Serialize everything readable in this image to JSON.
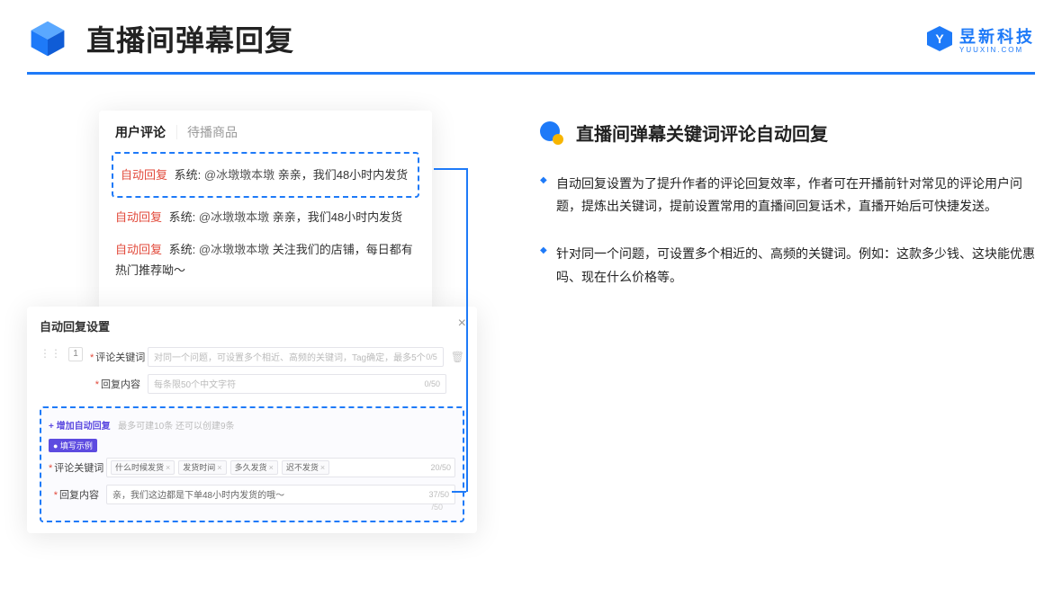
{
  "header": {
    "title": "直播间弹幕回复",
    "brand_text": "昱新科技",
    "brand_sub": "YUUXIN.COM",
    "brand_letter": "Y"
  },
  "right": {
    "title": "直播间弹幕关键词评论自动回复",
    "bullets": [
      "自动回复设置为了提升作者的评论回复效率，作者可在开播前针对常见的评论用户问题，提炼出关键词，提前设置常用的直播间回复话术，直播开始后可快捷发送。",
      "针对同一个问题，可设置多个相近的、高频的关键词。例如：这款多少钱、这块能优惠吗、现在什么价格等。"
    ]
  },
  "comments": {
    "tabs": [
      "用户评论",
      "待播商品"
    ],
    "rows": [
      {
        "tag": "自动回复",
        "prefix": "系统:",
        "mention": "@冰墩墩本墩",
        "text": " 亲亲，我们48小时内发货"
      },
      {
        "tag": "自动回复",
        "prefix": "系统:",
        "mention": "@冰墩墩本墩",
        "text": " 亲亲，我们48小时内发货"
      },
      {
        "tag": "自动回复",
        "prefix": "系统:",
        "mention": "@冰墩墩本墩",
        "text": " 关注我们的店铺，每日都有热门推荐呦～"
      }
    ]
  },
  "settings": {
    "title": "自动回复设置",
    "close": "×",
    "index": "1",
    "labels": {
      "keyword": "评论关键词",
      "reply": "回复内容"
    },
    "placeholders": {
      "keyword": "对同一个问题，可设置多个相近、高频的关键词，Tag确定，最多5个",
      "reply": "每条限50个中文字符"
    },
    "counters": {
      "keyword": "0/5",
      "reply": "0/50",
      "ex_keyword": "20/50",
      "ex_reply": "37/50",
      "trailing": "/50"
    },
    "add_link": "+ 增加自动回复",
    "add_hint": "最多可建10条 还可以创建9条",
    "example_badge": "● 填写示例",
    "example_keywords": [
      "什么时候发货",
      "发货时间",
      "多久发货",
      "迟不发货"
    ],
    "example_reply": "亲，我们这边都是下单48小时内发货的哦～"
  }
}
